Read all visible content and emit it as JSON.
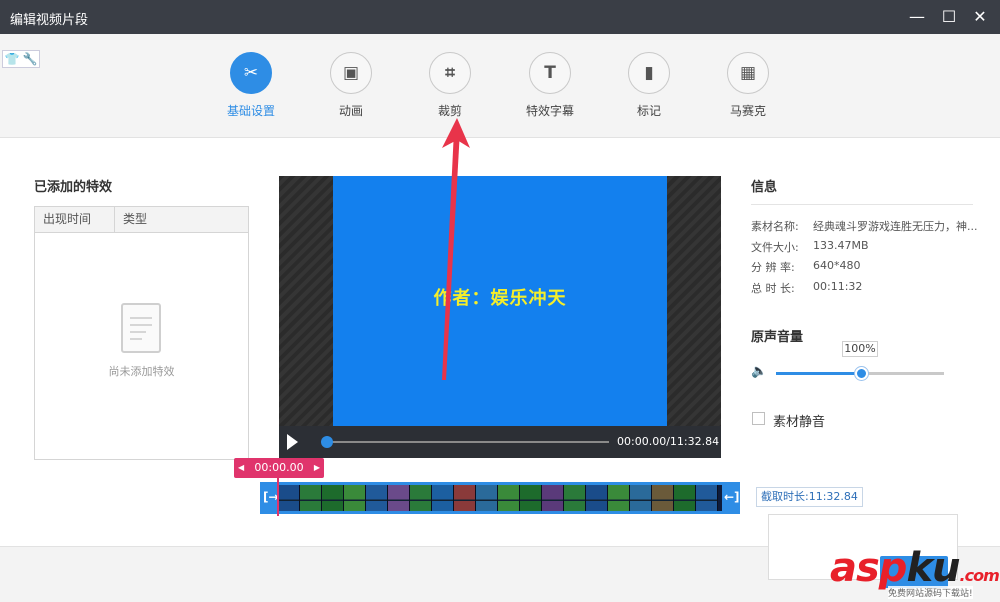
{
  "window": {
    "title": "编辑视频片段",
    "minimize_icon": "minimize-icon",
    "maximize_icon": "maximize-icon",
    "close_icon": "close-icon"
  },
  "skin_icons": [
    "shirt-icon",
    "wrench-icon"
  ],
  "toolbar": {
    "tools": [
      {
        "label": "基础设置",
        "icon": "scissors-icon",
        "glyph": "✂",
        "active": true
      },
      {
        "label": "动画",
        "icon": "animation-icon",
        "glyph": "▣",
        "active": false
      },
      {
        "label": "裁剪",
        "icon": "crop-icon",
        "glyph": "⌗",
        "active": false
      },
      {
        "label": "特效字幕",
        "icon": "text-icon",
        "glyph": "T",
        "active": false
      },
      {
        "label": "标记",
        "icon": "bookmark-icon",
        "glyph": "▮",
        "active": false
      },
      {
        "label": "马赛克",
        "icon": "mosaic-icon",
        "glyph": "▦",
        "active": false
      }
    ],
    "accent": "#2e8de5"
  },
  "effects_panel": {
    "title": "已添加的特效",
    "columns": [
      "出现时间",
      "类型"
    ],
    "empty_text": "尚未添加特效"
  },
  "preview": {
    "caption": "作者：娱乐冲天",
    "timecode": "00:00.00/11:32.84",
    "screen_color": "#1380ee",
    "caption_color": "#f5ee2a"
  },
  "timeline": {
    "current_time": "00:00.00",
    "duration_label": "截取时长:11:32.84",
    "frame_colors": [
      "#1a4c8a",
      "#2a7a3a",
      "#1d6b2c",
      "#3a8a3a",
      "#205a9a",
      "#6a4a8a",
      "#2a7a3a",
      "#1c5fa0",
      "#8a3a3a",
      "#2a6a9a",
      "#3a8a3a",
      "#1d6b2c",
      "#5a3a7a",
      "#2a7a3a",
      "#1a4c8a",
      "#3a8a3a",
      "#2a6a9a",
      "#6a5a3a",
      "#1d6b2c",
      "#205a9a"
    ]
  },
  "info": {
    "title": "信息",
    "rows": [
      {
        "key": "素材名称:",
        "value": "经典魂斗罗游戏连胜无压力，神..."
      },
      {
        "key": "文件大小:",
        "value": "133.47MB"
      },
      {
        "key": "分 辨 率:",
        "value": "640*480"
      },
      {
        "key": "总 时 长:",
        "value": "00:11:32"
      }
    ]
  },
  "volume": {
    "title": "原声音量",
    "value_label": "100%",
    "level": 0.5
  },
  "mute": {
    "label": "素材静音",
    "checked": false
  },
  "annotation": {
    "arrow_color": "#e8344a"
  },
  "watermark": {
    "brand_a": "asp",
    "brand_b": "ku",
    "brand_c": ".com",
    "sub": "免费网站源码下载站!"
  }
}
